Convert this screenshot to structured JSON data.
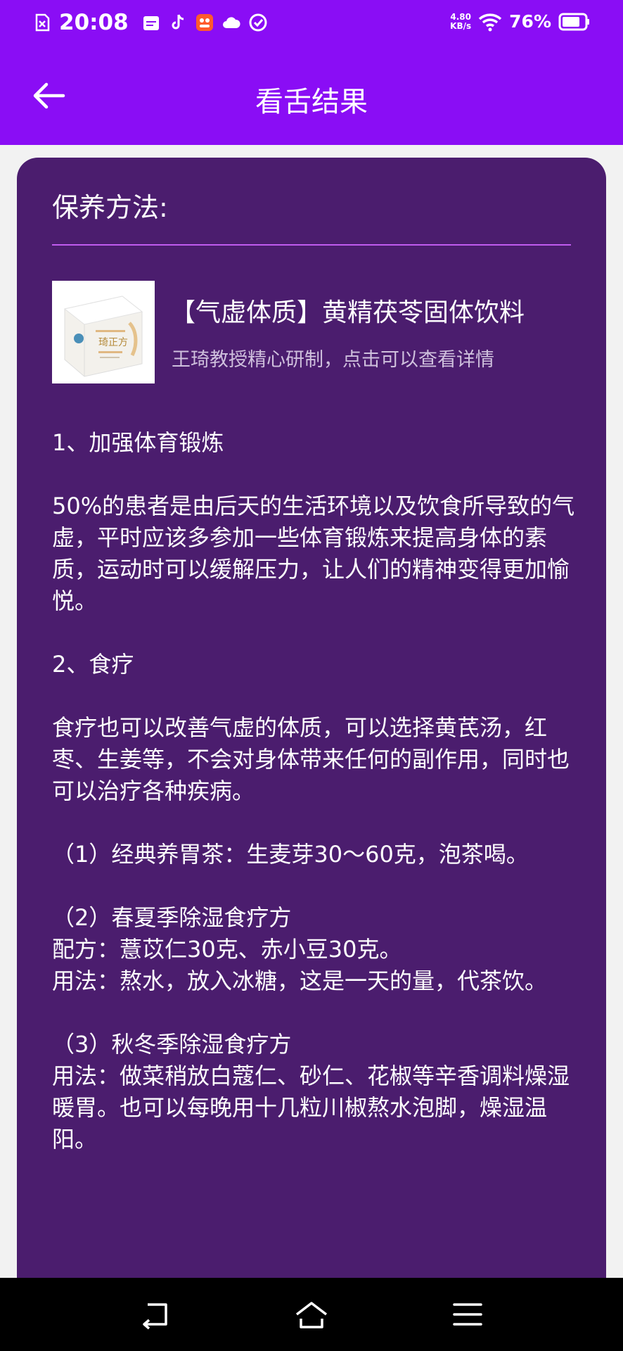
{
  "status_bar": {
    "time": "20:08",
    "net_speed_value": "4.80",
    "net_speed_unit": "KB/s",
    "battery": "76%",
    "icons": [
      "sim-icon",
      "calendar-icon",
      "tiktok-icon",
      "app-icon",
      "cloud-icon",
      "checkmark-icon",
      "wifi-icon",
      "battery-icon"
    ]
  },
  "app_bar": {
    "title": "看舌结果",
    "back_icon": "arrow-left-icon"
  },
  "card": {
    "section_title": "保养方法:",
    "product": {
      "name": "【气虚体质】黄精茯苓固体饮料",
      "description": "王琦教授精心研制，点击可以查看详情",
      "image_text": "琦正方"
    },
    "paragraphs": [
      "1、加强体育锻炼",
      "50%的患者是由后天的生活环境以及饮食所导致的气虚，平时应该多参加一些体育锻炼来提高身体的素质，运动时可以缓解压力，让人们的精神变得更加愉悦。",
      "2、食疗",
      "食疗也可以改善气虚的体质，可以选择黄芪汤，红枣、生姜等，不会对身体带来任何的副作用，同时也可以治疗各种疾病。",
      "（1）经典养胃茶：生麦芽30～60克，泡茶喝。",
      "（2）春夏季除湿食疗方\n 配方：薏苡仁30克、赤小豆30克。\n 用法：熬水，放入冰糖，这是一天的量，代茶饮。",
      "（3）秋冬季除湿食疗方\n 用法：做菜稍放白蔻仁、砂仁、花椒等辛香调料燥湿暖胃。也可以每晚用十几粒川椒熬水泡脚，燥湿温阳。"
    ]
  },
  "nav_bar": {
    "icons": [
      "back-nav-icon",
      "home-icon",
      "menu-icon"
    ]
  },
  "colors": {
    "primary": "#8a0df5",
    "card_bg": "#4b1d6e",
    "divider": "#c15cf0",
    "page_bg": "#f2f2f2"
  }
}
